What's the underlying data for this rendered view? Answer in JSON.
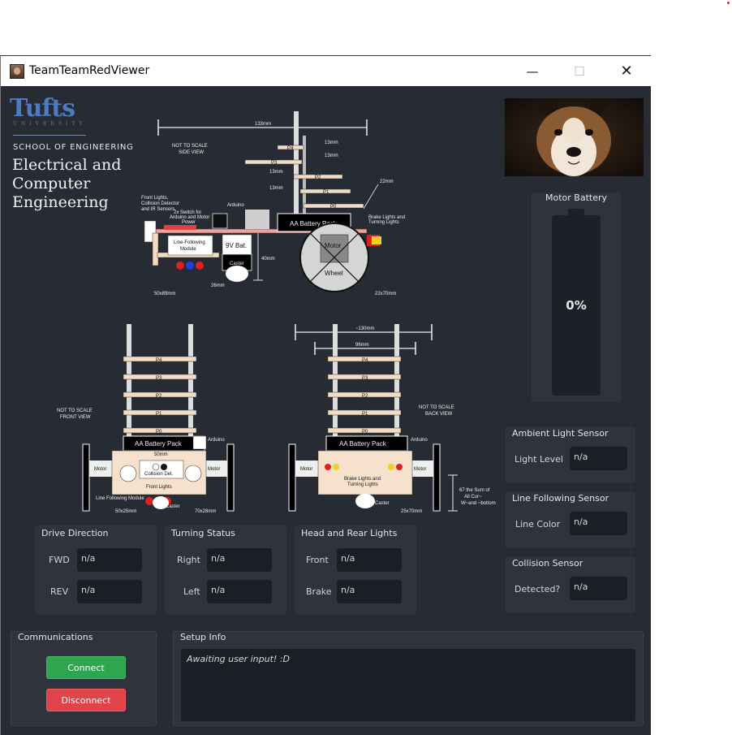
{
  "window": {
    "title": "TeamTeamRedViewer",
    "minimize_glyph": "—",
    "maximize_glyph": "☐",
    "close_glyph": "✕"
  },
  "logo": {
    "tufts": "Tufts",
    "university": "UNIVERSITY",
    "school": "SCHOOL OF ENGINEERING",
    "department_line1": "Electrical and",
    "department_line2": "Computer",
    "department_line3": "Engineering"
  },
  "diagram": {
    "side_view": {
      "title_line1": "NOT TO SCALE",
      "title_line2": "SIDE VIEW",
      "shelves": [
        "P4",
        "P3",
        "P2",
        "P1",
        "P0"
      ],
      "labels": {
        "front_lights": "Front Lights,",
        "collision_detector": "Collision Detector",
        "ir_sensors": "and IR Sensors",
        "switch_line1": "2x Switch for",
        "switch_line2": "Arduino and Motor",
        "switch_line3": "Power",
        "arduino": "Arduino",
        "aa_pack": "AA Battery Pack",
        "line_following_line1": "Line-Following",
        "line_following_line2": "Module",
        "battery_9v": "9V Bat.",
        "caster": "Caster",
        "motor": "Motor",
        "wheel": "Wheel",
        "brake_lights_line1": "Brake Lights and",
        "brake_lights_line2": "Turning Lights",
        "dim_top": "133mm",
        "dim_p4": "13mm",
        "dim_p3": "13mm",
        "dim_p2": "13mm",
        "dim_p1": "13mm",
        "dim_right": "22mm",
        "dim_height": "40mm",
        "dim_bottom_left": "50x89mm",
        "dim_bottom_mid": "26mm",
        "dim_bottom_right": "22x70mm"
      }
    },
    "front_view": {
      "title_line1": "NOT TO SCALE",
      "title_line2": "FRONT VIEW",
      "shelves": [
        "P4",
        "P3",
        "P2",
        "P1",
        "P0"
      ],
      "labels": {
        "aa_pack": "AA Battery Pack",
        "arduino": "Arduino",
        "width": "50mm",
        "collision": "Collision Det.",
        "front_lights": "Front Lights",
        "motor_left": "Motor",
        "motor_right": "Motor",
        "line_following": "Line Following Module",
        "caster": "Caster",
        "dim_left": "50x25mm",
        "dim_right": "70x28mm"
      }
    },
    "back_view": {
      "title_line1": "NOT TO SCALE",
      "title_line2": "BACK VIEW",
      "shelves": [
        "P4",
        "P3",
        "P2",
        "P1",
        "P0"
      ],
      "labels": {
        "dim_top": "~130mm",
        "dim_second": "96mm",
        "aa_pack": "AA Battery Pack",
        "arduino": "Arduino",
        "motor_left": "Motor",
        "motor_right": "Motor",
        "brake_line1": "Brake Lights and",
        "brake_line2": "Turning Lights",
        "caster": "Caster",
        "dim_bottom": "25x70mm",
        "clearance_line1": "67 the Sum of",
        "clearance_line2": "All Cur~",
        "clearance_line3": "W~and ~bottom"
      }
    }
  },
  "battery": {
    "title": "Motor Battery",
    "percent_text": "0%",
    "level_percent": 0
  },
  "ambient_sensor": {
    "title": "Ambient Light Sensor",
    "label": "Light Level",
    "value": "n/a"
  },
  "line_sensor": {
    "title": "Line Following Sensor",
    "label": "Line Color",
    "value": "n/a"
  },
  "collision_sensor": {
    "title": "Collision Sensor",
    "label": "Detected?",
    "value": "n/a"
  },
  "drive_direction": {
    "title": "Drive Direction",
    "fwd_label": "FWD",
    "fwd_value": "n/a",
    "rev_label": "REV",
    "rev_value": "n/a"
  },
  "turning_status": {
    "title": "Turning Status",
    "right_label": "Right",
    "right_value": "n/a",
    "left_label": "Left",
    "left_value": "n/a"
  },
  "lights": {
    "title": "Head and Rear Lights",
    "front_label": "Front",
    "front_value": "n/a",
    "brake_label": "Brake",
    "brake_value": "n/a"
  },
  "communications": {
    "title": "Communications",
    "connect_label": "Connect",
    "disconnect_label": "Disconnect"
  },
  "setup_info": {
    "title": "Setup Info",
    "text": "Awaiting user input! :D"
  },
  "colors": {
    "background": "#272b34",
    "panel": "#2f333d",
    "field": "#1b1e24",
    "connect": "#2ea64f",
    "disconnect": "#e0434a",
    "tufts_blue": "#4d7bbd"
  },
  "icons": {
    "app": "user-photo-icon",
    "minimize": "minimize-icon",
    "maximize": "maximize-icon",
    "close": "close-icon"
  }
}
